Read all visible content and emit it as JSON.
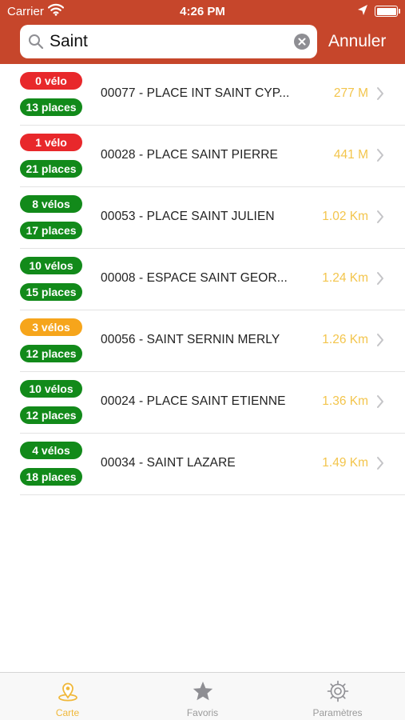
{
  "status_bar": {
    "carrier": "Carrier",
    "time": "4:26 PM"
  },
  "search": {
    "value": "Saint",
    "cancel_label": "Annuler"
  },
  "stations": [
    {
      "bikes": "0 vélo",
      "bikes_color": "#e8282b",
      "places": "13 places",
      "name": "00077 - PLACE INT SAINT CYP...",
      "distance": "277 M"
    },
    {
      "bikes": "1 vélo",
      "bikes_color": "#e8282b",
      "places": "21 places",
      "name": "00028 - PLACE SAINT PIERRE",
      "distance": "441 M"
    },
    {
      "bikes": "8 vélos",
      "bikes_color": "#128a1a",
      "places": "17 places",
      "name": "00053 - PLACE SAINT JULIEN",
      "distance": "1.02 Km"
    },
    {
      "bikes": "10 vélos",
      "bikes_color": "#128a1a",
      "places": "15 places",
      "name": "00008 - ESPACE SAINT GEOR...",
      "distance": "1.24 Km"
    },
    {
      "bikes": "3 vélos",
      "bikes_color": "#f6a51b",
      "places": "12 places",
      "name": "00056 - SAINT SERNIN  MERLY",
      "distance": "1.26 Km"
    },
    {
      "bikes": "10 vélos",
      "bikes_color": "#128a1a",
      "places": "12 places",
      "name": "00024 - PLACE SAINT ETIENNE",
      "distance": "1.36 Km"
    },
    {
      "bikes": "4 vélos",
      "bikes_color": "#128a1a",
      "places": "18 places",
      "name": "00034 - SAINT LAZARE",
      "distance": "1.49 Km"
    }
  ],
  "places_color": "#128a1a",
  "tabs": [
    {
      "label": "Carte",
      "icon": "map-pin-icon",
      "active": true
    },
    {
      "label": "Favoris",
      "icon": "star-icon",
      "active": false
    },
    {
      "label": "Paramètres",
      "icon": "gear-icon",
      "active": false
    }
  ],
  "colors": {
    "header": "#c6462b",
    "accent": "#f0b83a",
    "distance": "#f3c54c"
  }
}
